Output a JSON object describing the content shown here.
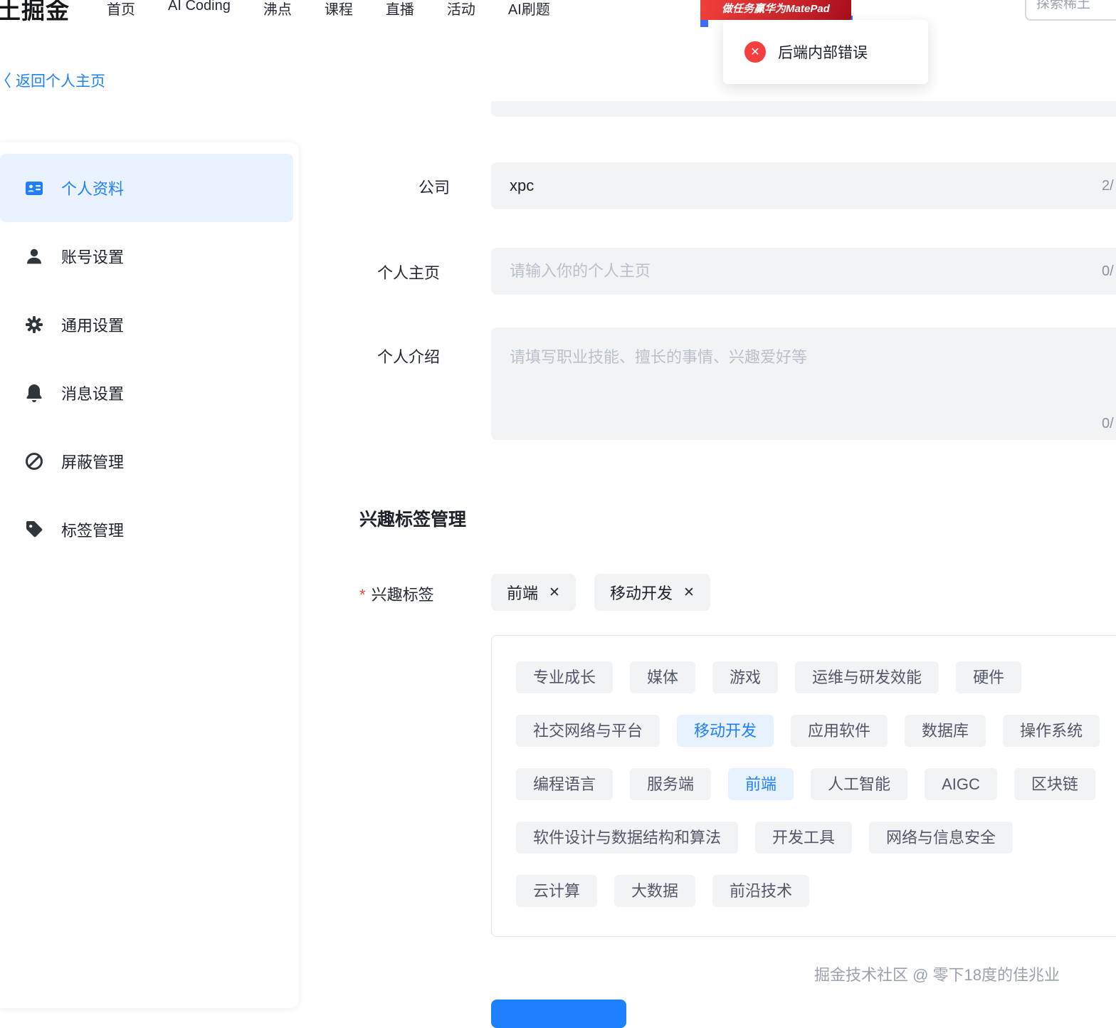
{
  "nav": {
    "logo": "土掘金",
    "items": [
      "首页",
      "AI Coding",
      "沸点",
      "课程",
      "直播",
      "活动",
      "AI刷题"
    ],
    "promo_text": "做任务赢华为MatePad",
    "search_placeholder": "探索稀土"
  },
  "toast": {
    "icon_glyph": "✕",
    "message": "后端内部错误"
  },
  "back_link": {
    "arrow": "〈",
    "label": "返回个人主页"
  },
  "sidebar": {
    "items": [
      {
        "label": "个人资料"
      },
      {
        "label": "账号设置"
      },
      {
        "label": "通用设置"
      },
      {
        "label": "消息设置"
      },
      {
        "label": "屏蔽管理"
      },
      {
        "label": "标签管理"
      }
    ]
  },
  "form": {
    "company": {
      "label": "公司",
      "value": "xpc",
      "counter": "2/"
    },
    "homepage": {
      "label": "个人主页",
      "placeholder": "请输入你的个人主页",
      "counter": "0/"
    },
    "intro": {
      "label": "个人介绍",
      "placeholder": "请填写职业技能、擅长的事情、兴趣爱好等",
      "counter": "0/"
    }
  },
  "interest": {
    "heading": "兴趣标签管理",
    "required_mark": "*",
    "field_label": "兴趣标签",
    "remove_icon": "✕",
    "selected_tags": [
      {
        "label": "前端"
      },
      {
        "label": "移动开发"
      }
    ],
    "rows": [
      [
        "专业成长",
        "媒体",
        "游戏",
        "运维与研发效能",
        "硬件"
      ],
      [
        "社交网络与平台",
        "移动开发",
        "应用软件",
        "数据库",
        "操作系统"
      ],
      [
        "编程语言",
        "服务端",
        "前端",
        "人工智能",
        "AIGC",
        "区块链"
      ],
      [
        "软件设计与数据结构和算法",
        "开发工具",
        "网络与信息安全"
      ],
      [
        "云计算",
        "大数据",
        "前沿技术"
      ]
    ]
  },
  "watermark": "掘金技术社区 @ 零下18度的佳兆业",
  "colors": {
    "accent": "#1e80ff",
    "error_red": "#f53f3f",
    "selected_tag_bg": "#e8f2ff",
    "tag_bg": "#f2f3f5"
  }
}
